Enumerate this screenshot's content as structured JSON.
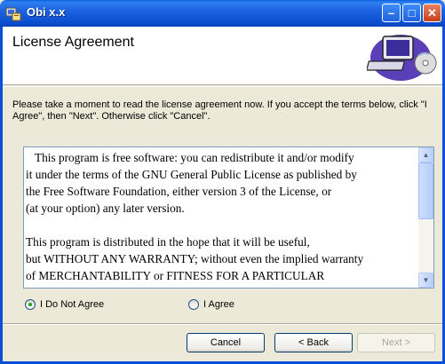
{
  "window": {
    "title": "Obi x.x",
    "minimize_glyph": "–",
    "maximize_glyph": "□",
    "close_glyph": "✕"
  },
  "header": {
    "title": "License Agreement",
    "art_icon": "computer-cd-icon"
  },
  "instructions": "Please take a moment to read the license agreement now. If you accept the terms below, click \"I Agree\", then \"Next\". Otherwise click \"Cancel\".",
  "license": {
    "text": "   This program is free software: you can redistribute it and/or modify\nit under the terms of the GNU General Public License as published by\nthe Free Software Foundation, either version 3 of the License, or\n(at your option) any later version.\n\nThis program is distributed in the hope that it will be useful,\nbut WITHOUT ANY WARRANTY; without even the implied warranty\nof MERCHANTABILITY or FITNESS FOR A PARTICULAR",
    "scroll_up": "▲",
    "scroll_down": "▼"
  },
  "options": {
    "disagree_label": "I Do Not Agree",
    "agree_label": "I Agree",
    "selected": "disagree"
  },
  "buttons": {
    "cancel": "Cancel",
    "back": "< Back",
    "next": "Next >"
  },
  "colors": {
    "titlebar": "#0b50d6",
    "dialog_bg": "#ece9d8",
    "radio_selected": "#21a121",
    "button_border": "#003c74"
  }
}
